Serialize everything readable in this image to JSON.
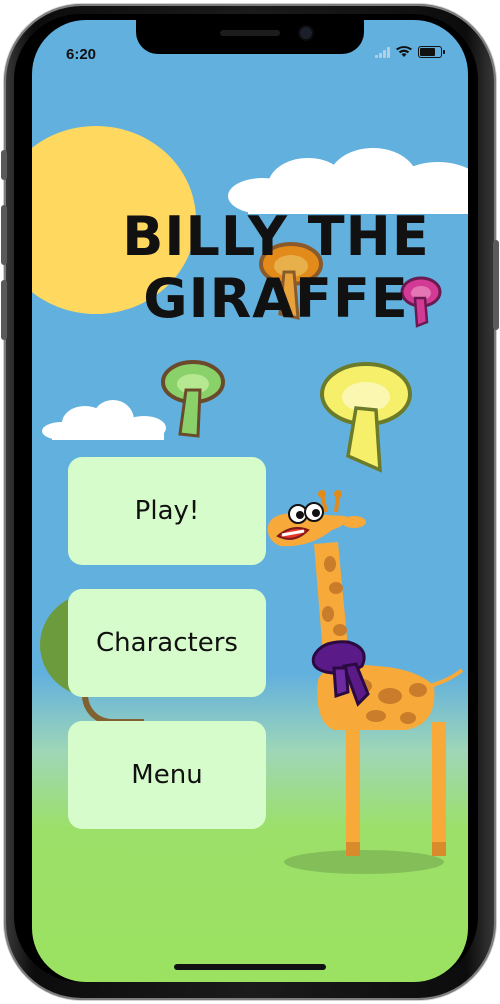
{
  "status_bar": {
    "time": "6:20",
    "icons": [
      "cellular-signal-icon",
      "wifi-icon",
      "battery-icon"
    ]
  },
  "game": {
    "title_line1": "BILLY THE",
    "title_line2": "GIRAFFE",
    "buttons": {
      "play_label": "Play!",
      "characters_label": "Characters",
      "menu_label": "Menu"
    },
    "colors": {
      "sky": "#62b0de",
      "grass": "#9be261",
      "sun": "#ffd860",
      "button_bg": "#d7fccc",
      "giraffe_body": "#f7a93a",
      "giraffe_spots": "#c97d2a",
      "scarf": "#5a1a87"
    },
    "decorations": [
      "sun",
      "cloud",
      "mushroom-icon",
      "tree",
      "giraffe-character"
    ]
  }
}
